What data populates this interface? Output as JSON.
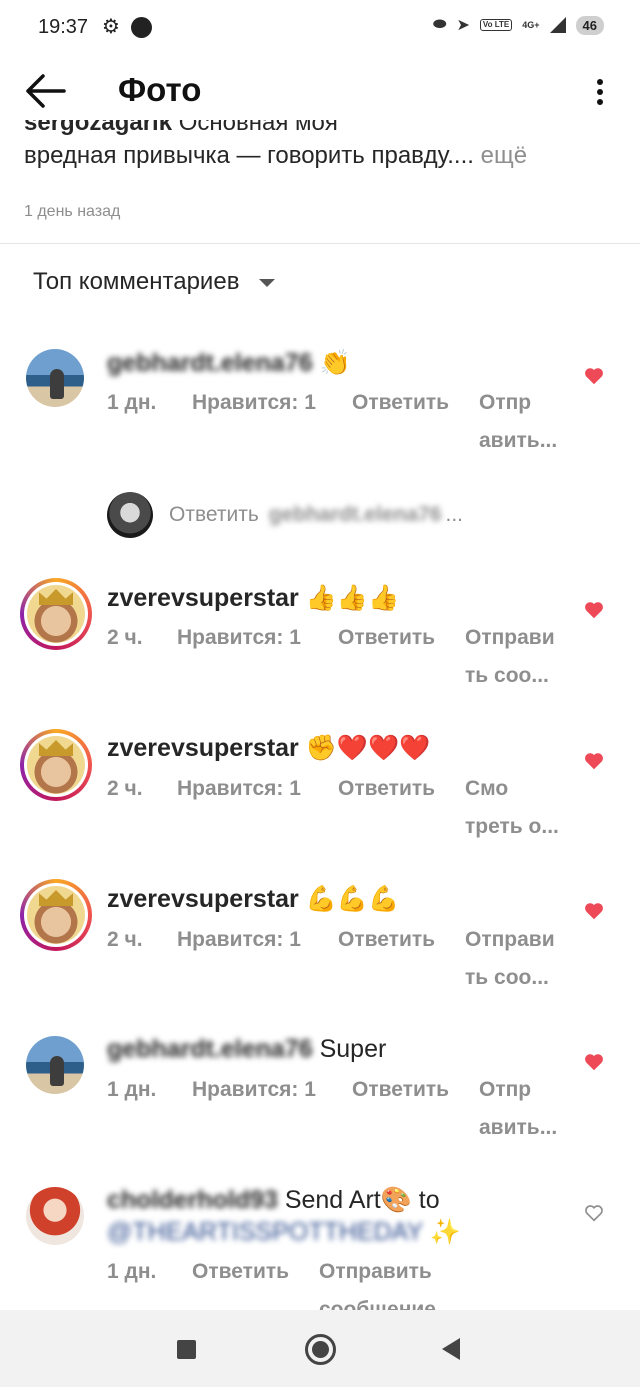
{
  "status_bar": {
    "time": "19:37",
    "battery": "46",
    "network": "4G+",
    "volte": "Vo LTE",
    "icons": [
      "gear-icon",
      "notification-dot-icon",
      "messenger-icon",
      "telegram-icon",
      "volte-icon",
      "signal-icon",
      "battery-icon"
    ]
  },
  "header": {
    "title": "Фото"
  },
  "caption": {
    "username": "sergozagarik",
    "text_first": "Основная моя",
    "text_second": "вредная привычка — говорить правду....",
    "more": "ещё",
    "date": "1 день назад"
  },
  "sort": {
    "label": "Топ комментариев"
  },
  "comments": [
    {
      "username": "gebhardt.elena76",
      "text": "👏",
      "time": "1 дн.",
      "likes": "Нравится: 1",
      "reply": "Ответить",
      "send_line1": "Отпр",
      "send_line2": "авить...",
      "liked": true
    },
    {
      "username": "zverevsuperstar",
      "text": "👍👍👍",
      "time": "2 ч.",
      "likes": "Нравится: 1",
      "reply": "Ответить",
      "send_line1": "Отправи",
      "send_line2": "ть соо...",
      "liked": true
    },
    {
      "username": "zverevsuperstar",
      "text": "✊❤️❤️❤️",
      "time": "2 ч.",
      "likes": "Нравится: 1",
      "reply": "Ответить",
      "send_line1": "Смо",
      "send_line2": "треть о...",
      "liked": true
    },
    {
      "username": "zverevsuperstar",
      "text": "💪💪💪",
      "time": "2 ч.",
      "likes": "Нравится: 1",
      "reply": "Ответить",
      "send_line1": "Отправи",
      "send_line2": "ть соо...",
      "liked": true
    },
    {
      "username": "gebhardt.elena76",
      "text": "Super",
      "time": "1 дн.",
      "likes": "Нравится: 1",
      "reply": "Ответить",
      "send_line1": "Отпр",
      "send_line2": "авить...",
      "liked": true
    },
    {
      "username": "cholderhold93",
      "text_before": "Send Art🎨 to",
      "mention": "@THEARTISSPOTTHEDAY",
      "text_after": "✨",
      "time": "1 дн.",
      "reply": "Ответить",
      "send_line1": "Отправить",
      "send_line2": "сообщение",
      "liked": false
    }
  ],
  "reply_input": {
    "label": "Ответить",
    "target": "gebhardt.elena76",
    "dots": "..."
  },
  "colors": {
    "like_red": "#ed4956",
    "meta_gray": "#8e8e8e",
    "text": "#262626",
    "link_blue": "#2b4a8c"
  }
}
